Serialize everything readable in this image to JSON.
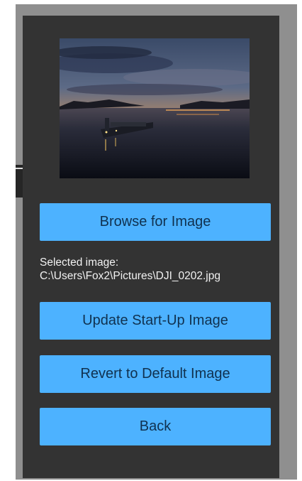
{
  "preview": {
    "icon": "sunset-ship-photo"
  },
  "buttons": {
    "browse_label": "Browse for Image",
    "update_label": "Update Start-Up Image",
    "revert_label": "Revert to Default Image",
    "back_label": "Back"
  },
  "selected": {
    "label": "Selected image:",
    "path": "C:\\Users\\Fox2\\Pictures\\DJI_0202.jpg"
  },
  "colors": {
    "panel_bg": "#333333",
    "frame": "#8f8f8f",
    "button_bg": "#4db2ff",
    "button_text": "#10314f",
    "text": "#f2f2f2"
  }
}
